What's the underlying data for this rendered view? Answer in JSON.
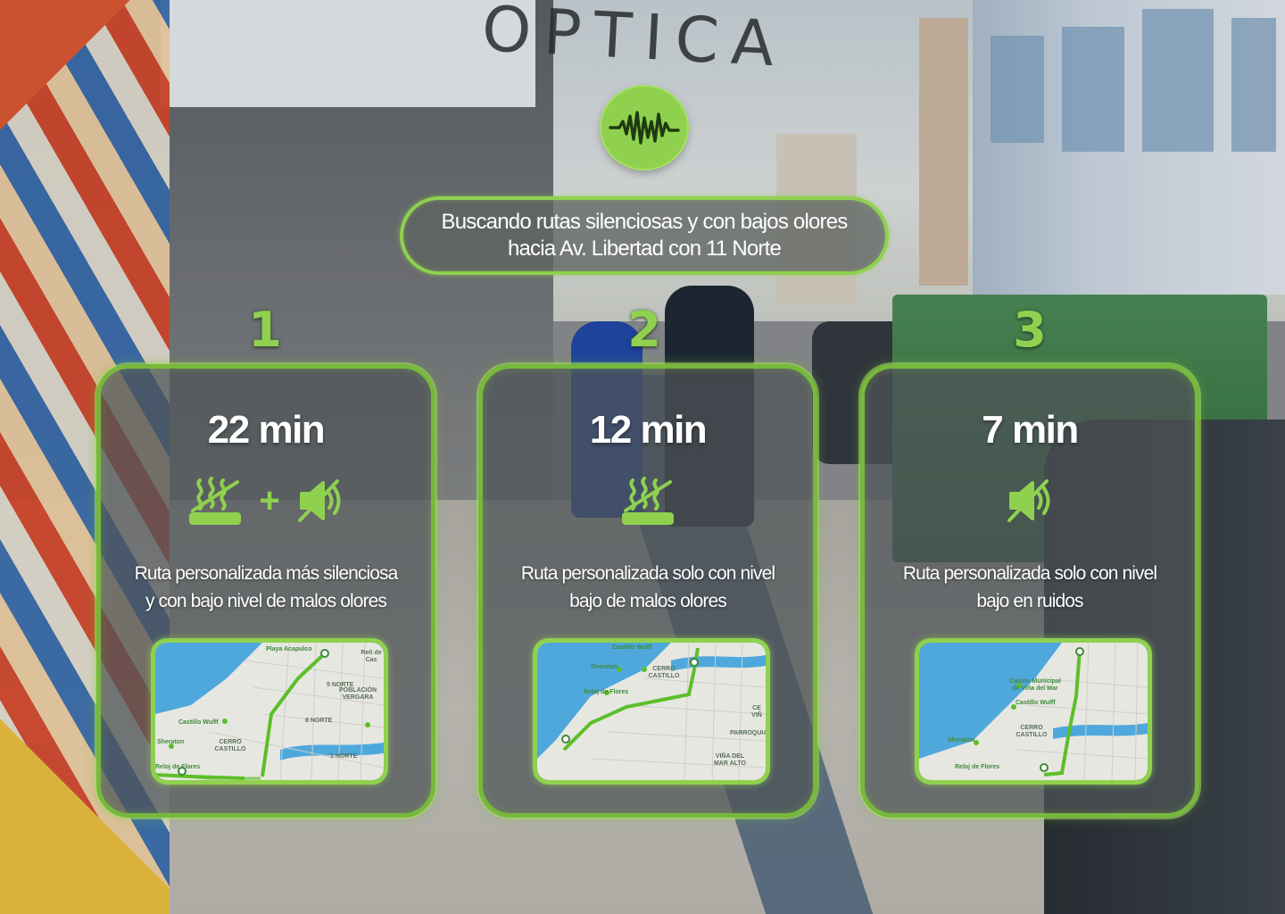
{
  "header": {
    "logo_icon": "sound-wave-icon",
    "search_line1": "Buscando rutas silenciosas y con bajos olores",
    "search_line2": "hacia  Av. Libertad con 11 Norte"
  },
  "background": {
    "storefront_sign": "OPTICA"
  },
  "colors": {
    "accent": "#8fd14f",
    "card_border": "#77b83d",
    "route": "#5cbf2a",
    "water": "#4fa8dc"
  },
  "routes": [
    {
      "number": "1",
      "time": "22 min",
      "icons": [
        "low-odor-icon",
        "plus",
        "muted-sound-icon"
      ],
      "plus_symbol": "+",
      "description_line1": "Ruta personalizada más silenciosa",
      "description_line2": "y con bajo nivel de malos olores",
      "map_labels": [
        "Playa Acapulco",
        "Reñ de Cas",
        "POBLACIÓN VERGARA",
        "Castillo Wulff",
        "Sheraton",
        "CERRO CASTILLO",
        "Reloj de Flores",
        "8 NORTE",
        "5 NORTE",
        "1 NORTE"
      ]
    },
    {
      "number": "2",
      "time": "12 min",
      "icons": [
        "low-odor-icon"
      ],
      "description_line1": "Ruta personalizada solo con nivel",
      "description_line2": "bajo de malos olores",
      "map_labels": [
        "Castillo Wulff",
        "Sheraton",
        "CERRO CASTILLO",
        "Reloj de Flores",
        "PARROQUIA",
        "VIÑA DEL MAR ALTO",
        "CE VIÑ"
      ]
    },
    {
      "number": "3",
      "time": "7 min",
      "icons": [
        "muted-sound-icon"
      ],
      "description_line1": "Ruta personalizada solo con nivel",
      "description_line2": "bajo en ruidos",
      "map_labels": [
        "Casino Municipal de Viña del Mar",
        "Castillo Wulff",
        "CERRO CASTILLO",
        "Sheraton",
        "Reloj de Flores"
      ]
    }
  ]
}
